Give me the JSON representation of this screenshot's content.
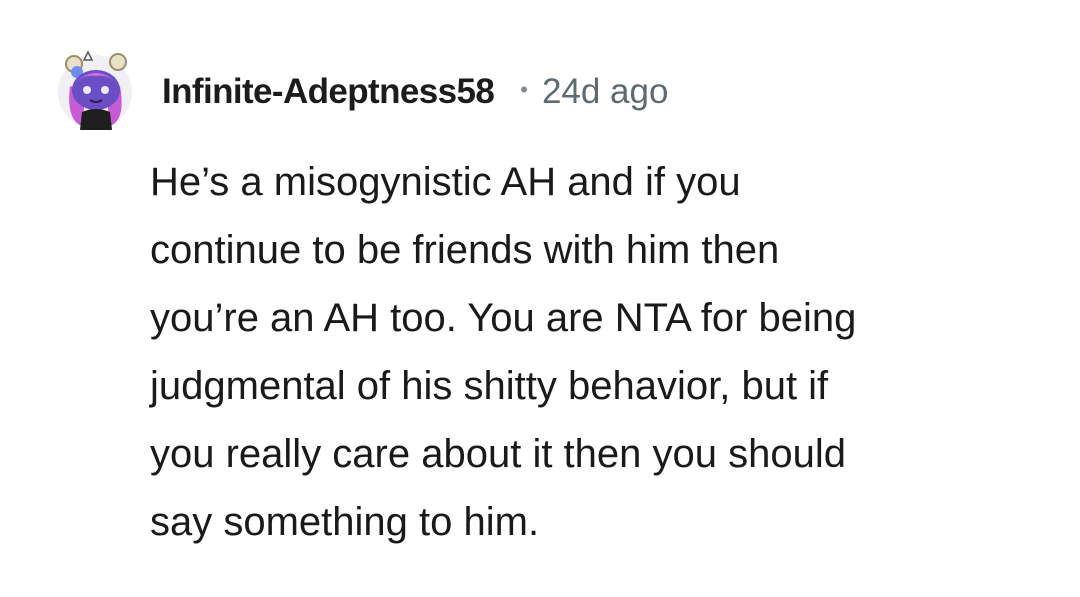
{
  "comment": {
    "username": "Infinite-Adeptness58",
    "separator": "•",
    "timestamp": "24d ago",
    "avatar_icon": "snoo-avatar-icon",
    "body_lines": [
      "He’s a misogynistic AH and if you",
      "continue to be friends with him then",
      "you’re an AH too. You are NTA for being",
      "judgmental of his shitty behavior, but if",
      "you really care about it then you should",
      "say something to him."
    ]
  },
  "colors": {
    "username": "#1c1c1c",
    "timestamp": "#5c6b72",
    "body": "#1a1a1a",
    "background": "#ffffff",
    "avatar_face": "#6a4fc4",
    "avatar_hair": "#c75bd6"
  }
}
